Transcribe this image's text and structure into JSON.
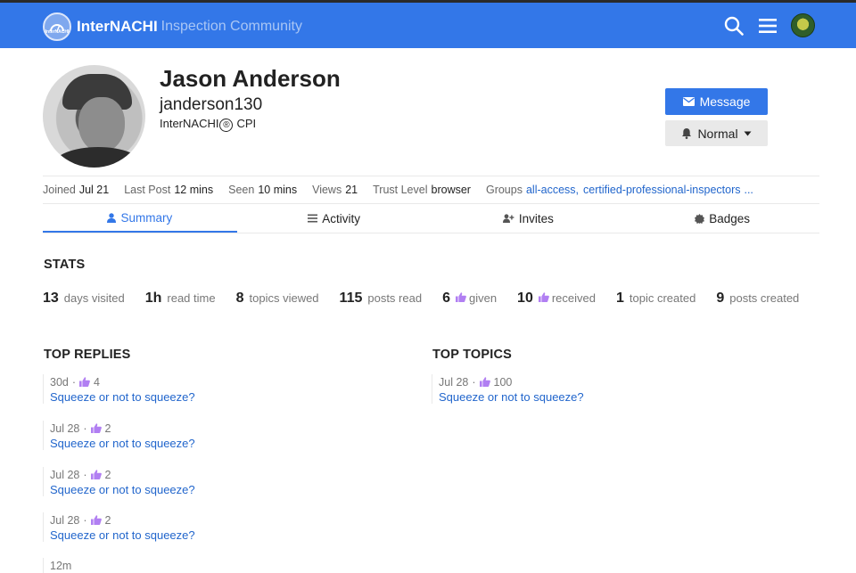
{
  "header": {
    "brand": "InterNACHI",
    "subtitle": "Inspection Community",
    "logo_text": "InterNACHI",
    "icons": [
      "search-icon",
      "hamburger-menu-icon",
      "user-avatar"
    ]
  },
  "profile": {
    "name": "Jason Anderson",
    "username": "janderson130",
    "title_prefix": "InterNACHI",
    "title_mark": "®",
    "title_suffix": "CPI",
    "message_button": "Message",
    "notification_level": "Normal"
  },
  "meta": {
    "joined_label": "Joined",
    "joined": "Jul 21",
    "last_post_label": "Last Post",
    "last_post": "12 mins",
    "seen_label": "Seen",
    "seen": "10 mins",
    "views_label": "Views",
    "views": "21",
    "trust_label": "Trust Level",
    "trust": "browser",
    "groups_label": "Groups",
    "group1": "all-access,",
    "group2": "certified-professional-inspectors",
    "more": "..."
  },
  "nav": {
    "tabs": [
      {
        "label": "Summary",
        "icon": "user-icon",
        "active": true
      },
      {
        "label": "Activity",
        "icon": "list-icon",
        "active": false
      },
      {
        "label": "Invites",
        "icon": "user-plus-icon",
        "active": false
      },
      {
        "label": "Badges",
        "icon": "badge-icon",
        "active": false
      }
    ]
  },
  "stats_heading": "STATS",
  "stats": [
    {
      "n": "13",
      "t": "days visited"
    },
    {
      "n": "1h",
      "t": "read time"
    },
    {
      "n": "8",
      "t": "topics viewed"
    },
    {
      "n": "115",
      "t": "posts read"
    },
    {
      "n": "6",
      "t": "given"
    },
    {
      "n": "10",
      "t": "received"
    },
    {
      "n": "1",
      "t": "topic created"
    },
    {
      "n": "9",
      "t": "posts created"
    }
  ],
  "top_replies_heading": "TOP REPLIES",
  "top_replies": [
    {
      "date": "30d",
      "likes": "4",
      "title": "Squeeze or not to squeeze?"
    },
    {
      "date": "Jul 28",
      "likes": "2",
      "title": "Squeeze or not to squeeze?"
    },
    {
      "date": "Jul 28",
      "likes": "2",
      "title": "Squeeze or not to squeeze?"
    },
    {
      "date": "Jul 28",
      "likes": "2",
      "title": "Squeeze or not to squeeze?"
    },
    {
      "date": "12m",
      "likes": "",
      "title": ""
    }
  ],
  "top_topics_heading": "TOP TOPICS",
  "top_topics": [
    {
      "date": "Jul 28",
      "likes": "100",
      "title": "Squeeze or not to squeeze?"
    }
  ],
  "colors": {
    "accent": "#3377e8",
    "link": "#2266cc",
    "like": "#b17ff2"
  }
}
